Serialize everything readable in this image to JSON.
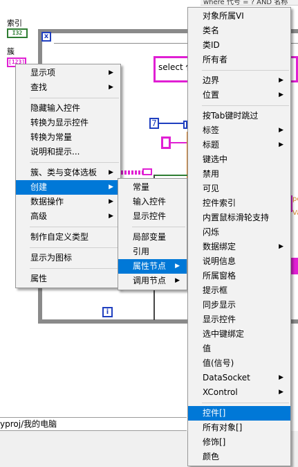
{
  "top_strip_text": "where 代号 = ? AND 名称",
  "diagram": {
    "index_label": "索引",
    "index_terminal": "I32",
    "cluster_label": "簇",
    "cluster_terminal": "[123]",
    "select_text": "select 代",
    "const_value": "7",
    "iteration_label": "i",
    "loop_stop_label": "x",
    "right_text_1": "pe",
    "right_text_2": "Va",
    "project_path": "yproj/我的电脑"
  },
  "context_menu": {
    "items": [
      {
        "label": "显示项",
        "submenu": true
      },
      {
        "label": "查找",
        "submenu": true
      },
      {
        "label": "隐藏输入控件"
      },
      {
        "label": "转换为显示控件"
      },
      {
        "label": "转换为常量"
      },
      {
        "label": "说明和提示..."
      },
      {
        "label": "簇、类与变体选板",
        "submenu": true
      },
      {
        "label": "创建",
        "submenu": true
      },
      {
        "label": "数据操作",
        "submenu": true
      },
      {
        "label": "高级",
        "submenu": true
      },
      {
        "label": "制作自定义类型"
      },
      {
        "label": "显示为图标"
      },
      {
        "label": "属性"
      }
    ]
  },
  "create_menu": {
    "items": [
      {
        "label": "常量"
      },
      {
        "label": "输入控件"
      },
      {
        "label": "显示控件"
      },
      {
        "label": "局部变量"
      },
      {
        "label": "引用"
      },
      {
        "label": "属性节点",
        "submenu": true
      },
      {
        "label": "调用节点",
        "submenu": true
      }
    ]
  },
  "property_menu": {
    "items": [
      {
        "label": "对象所属VI"
      },
      {
        "label": "类名"
      },
      {
        "label": "类ID"
      },
      {
        "label": "所有者"
      },
      {
        "label": "边界",
        "submenu": true
      },
      {
        "label": "位置",
        "submenu": true
      },
      {
        "label": "按Tab键时跳过"
      },
      {
        "label": "标签",
        "submenu": true
      },
      {
        "label": "标题",
        "submenu": true
      },
      {
        "label": "键选中"
      },
      {
        "label": "禁用"
      },
      {
        "label": "可见"
      },
      {
        "label": "控件索引"
      },
      {
        "label": "内置鼠标滑轮支持"
      },
      {
        "label": "闪烁"
      },
      {
        "label": "数据绑定",
        "submenu": true
      },
      {
        "label": "说明信息"
      },
      {
        "label": "所属窗格"
      },
      {
        "label": "提示框"
      },
      {
        "label": "同步显示"
      },
      {
        "label": "显示控件"
      },
      {
        "label": "选中键绑定"
      },
      {
        "label": "值"
      },
      {
        "label": "值(信号)"
      },
      {
        "label": "DataSocket",
        "submenu": true
      },
      {
        "label": "XControl",
        "submenu": true
      },
      {
        "label": "控件[]"
      },
      {
        "label": "所有对象[]"
      },
      {
        "label": "修饰[]"
      },
      {
        "label": "颜色"
      }
    ]
  },
  "arrow_glyph": "▶",
  "colors": {
    "highlight": "#0078d7",
    "menu_bg": "#f2f2f2",
    "numeric_wire": "#1f3fbf",
    "string_wire": "#e01fd3",
    "integer_terminal": "#2e7d32",
    "loop_frame": "#8a8a8a"
  }
}
